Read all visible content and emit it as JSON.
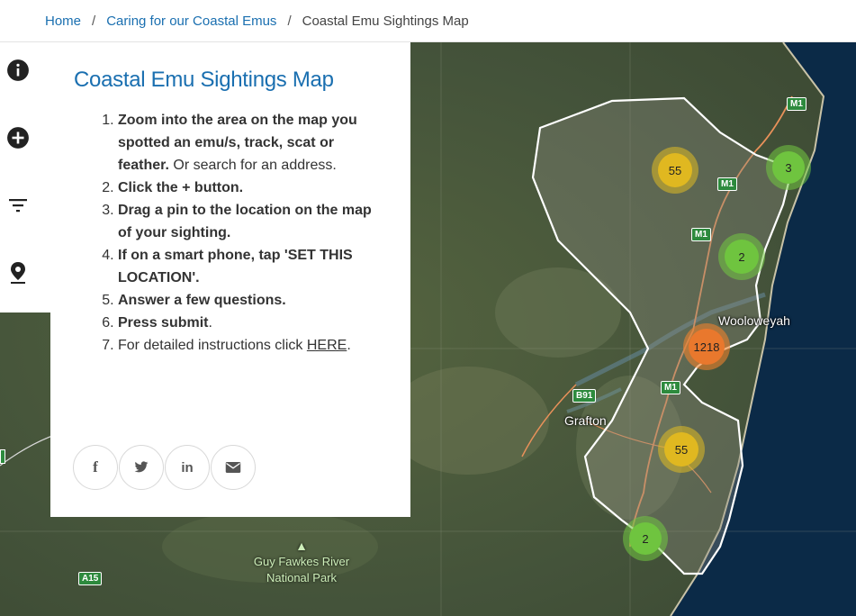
{
  "breadcrumb": {
    "home": "Home",
    "parent": "Caring for our Coastal Emus",
    "current": "Coastal Emu Sightings Map",
    "separator": "/"
  },
  "panel": {
    "title": "Coastal Emu Sightings Map",
    "steps": [
      {
        "bold": "Zoom into the area on the map you spotted an emu/s, track, scat or feather.",
        "rest": " Or search for an address."
      },
      {
        "bold": "Click the + button.",
        "rest": ""
      },
      {
        "bold": "Drag a pin to the location on the map of your sighting.",
        "rest": ""
      },
      {
        "bold": "If on a smart phone, tap 'SET THIS LOCATION'.",
        "rest": ""
      },
      {
        "bold": "Answer a few questions.",
        "rest": ""
      },
      {
        "bold": "Press submit",
        "rest": "."
      },
      {
        "bold": "",
        "rest": "For detailed instructions click ",
        "link": "HERE",
        "after": "."
      }
    ]
  },
  "toolbar": {
    "icons": [
      "info-icon",
      "add-icon",
      "filter-icon",
      "location-pin-icon"
    ]
  },
  "share": {
    "icons": [
      "facebook-icon",
      "twitter-icon",
      "linkedin-icon",
      "email-icon"
    ],
    "labels": {
      "facebook": "f",
      "linkedin": "in"
    }
  },
  "map": {
    "places": {
      "wooloweyah": "Wooloweyah",
      "grafton": "Grafton"
    },
    "park": "Guy Fawkes River\nNational Park",
    "roads": {
      "m1": "M1",
      "b91": "B91",
      "a15": "A15"
    },
    "clusters": [
      {
        "count": "55",
        "color": "yellow"
      },
      {
        "count": "3",
        "color": "green"
      },
      {
        "count": "2",
        "color": "green"
      },
      {
        "count": "1218",
        "color": "orange"
      },
      {
        "count": "55",
        "color": "yellow"
      },
      {
        "count": "2",
        "color": "green"
      }
    ]
  },
  "colors": {
    "link": "#1a6fb0",
    "ocean": "#0b2a47",
    "land": "#4b5a3a"
  }
}
